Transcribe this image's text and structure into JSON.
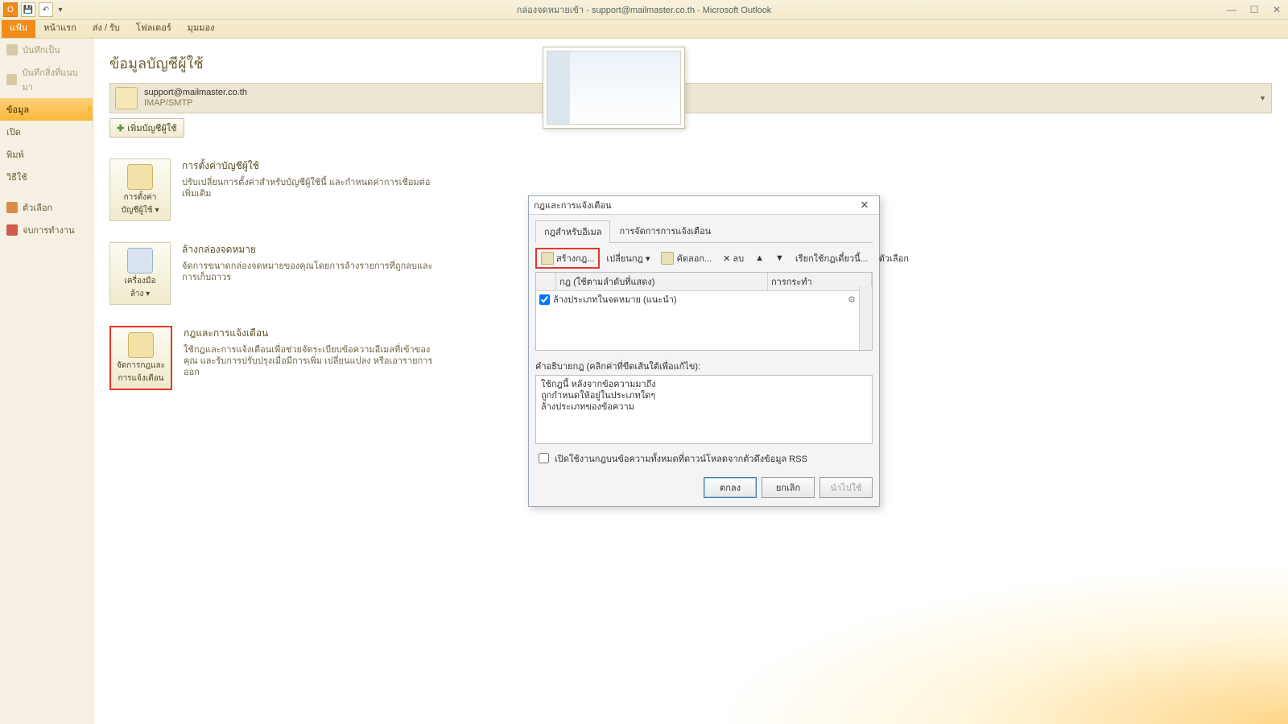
{
  "window": {
    "title": "กล่องจดหมายเข้า - support@mailmaster.co.th - Microsoft Outlook",
    "qat_letter": "O"
  },
  "ribbon": {
    "tabs": [
      "แฟ้ม",
      "หน้าแรก",
      "ส่ง / รับ",
      "โฟลเดอร์",
      "มุมมอง"
    ]
  },
  "sidebar": {
    "save_as": "บันทึกเป็น",
    "save_attachments": "บันทึกสิ่งที่แนบมา",
    "info": "ข้อมูล",
    "open": "เปิด",
    "print": "พิมพ์",
    "help": "วิธีใช้",
    "options": "ตัวเลือก",
    "exit": "จบการทำงาน"
  },
  "main": {
    "heading": "ข้อมูลบัญชีผู้ใช้",
    "account_email": "support@mailmaster.co.th",
    "account_proto": "IMAP/SMTP",
    "add_account_btn": "เพิ่มบัญชีผู้ใช้",
    "s1_btn_l1": "การตั้งค่า",
    "s1_btn_l2": "บัญชีผู้ใช้ ▾",
    "s1_title": "การตั้งค่าบัญชีผู้ใช้",
    "s1_desc": "ปรับเปลี่ยนการตั้งค่าสำหรับบัญชีผู้ใช้นี้ และกำหนดค่าการเชื่อมต่อเพิ่มเติม",
    "s2_btn_l1": "เครื่องมือ",
    "s2_btn_l2": "ล้าง ▾",
    "s2_title": "ล้างกล่องจดหมาย",
    "s2_desc": "จัดการขนาดกล่องจดหมายของคุณโดยการล้างรายการที่ถูกลบและการเก็บถาวร",
    "s3_btn_l1": "จัดการกฎและ",
    "s3_btn_l2": "การแจ้งเตือน",
    "s3_title": "กฎและการแจ้งเตือน",
    "s3_desc": "ใช้กฎและการแจ้งเตือนเพื่อช่วยจัดระเบียบข้อความอีเมลที่เข้าของคุณ และรับการปรับปรุงเมื่อมีการเพิ่ม เปลี่ยนแปลง หรือเอารายการออก"
  },
  "dialog": {
    "title": "กฎและการแจ้งเตือน",
    "tab1": "กฎสำหรับอีเมล",
    "tab2": "การจัดการการแจ้งเตือน",
    "tb_new": "สร้างกฎ...",
    "tb_change": "เปลี่ยนกฎ ▾",
    "tb_copy": "คัดลอก...",
    "tb_delete": "ลบ",
    "tb_run": "เรียกใช้กฎเดี๋ยวนี้...",
    "tb_opts": "ตัวเลือก",
    "col_rule": "กฎ (ใช้ตามลำดับที่แสดง)",
    "col_action": "การกระทำ",
    "rule1": "ล้างประเภทในจดหมาย (แนะนำ)",
    "desc_label": "คำอธิบายกฎ (คลิกค่าที่ขีดเส้นใต้เพื่อแก้ไข):",
    "desc_l1": "ใช้กฎนี้ หลังจากข้อความมาถึง",
    "desc_l2": "ถูกกำหนดให้อยู่ในประเภทใดๆ",
    "desc_l3": "ล้างประเภทของข้อความ",
    "rss": "เปิดใช้งานกฎบนข้อความทั้งหมดที่ดาวน์โหลดจากตัวดึงข้อมูล RSS",
    "ok": "ตกลง",
    "cancel": "ยกเลิก",
    "apply": "นำไปใช้"
  }
}
